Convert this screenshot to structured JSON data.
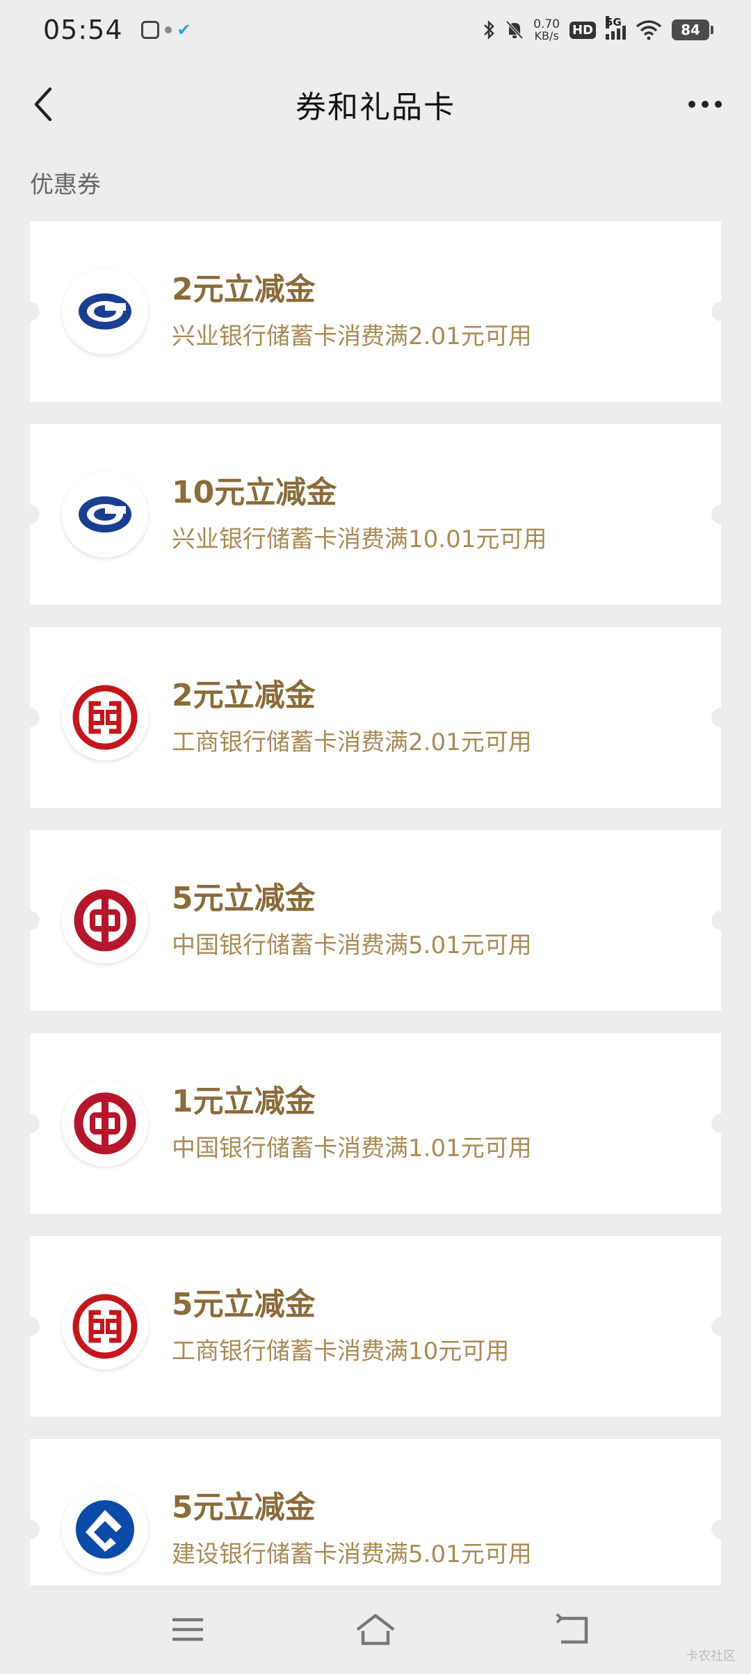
{
  "status_bar": {
    "time": "05:54",
    "net_speed_value": "0.70",
    "net_speed_unit": "KB/s",
    "hd": "HD",
    "network": "5G",
    "battery": "84"
  },
  "header": {
    "title": "券和礼品卡"
  },
  "section": {
    "label": "优惠券"
  },
  "coupons": [
    {
      "title": "2元立减金",
      "desc": "兴业银行储蓄卡消费满2.01元可用",
      "bank_icon": "cib-logo-icon"
    },
    {
      "title": "10元立减金",
      "desc": "兴业银行储蓄卡消费满10.01元可用",
      "bank_icon": "cib-logo-icon"
    },
    {
      "title": "2元立减金",
      "desc": "工商银行储蓄卡消费满2.01元可用",
      "bank_icon": "icbc-logo-icon"
    },
    {
      "title": "5元立减金",
      "desc": "中国银行储蓄卡消费满5.01元可用",
      "bank_icon": "boc-logo-icon"
    },
    {
      "title": "1元立减金",
      "desc": "中国银行储蓄卡消费满1.01元可用",
      "bank_icon": "boc-logo-icon"
    },
    {
      "title": "5元立减金",
      "desc": "工商银行储蓄卡消费满10元可用",
      "bank_icon": "icbc-logo-icon"
    },
    {
      "title": "5元立减金",
      "desc": "建设银行储蓄卡消费满5.01元可用",
      "bank_icon": "ccb-logo-icon"
    }
  ],
  "colors": {
    "coupon_title": "#8a6b3a",
    "coupon_desc": "#a98a55",
    "page_bg": "#ededed",
    "cib_blue": "#1b3f8f",
    "icbc_red": "#c4161c",
    "boc_red": "#b5162b",
    "ccb_blue": "#0a4aa8"
  },
  "watermark": "卡农社区"
}
